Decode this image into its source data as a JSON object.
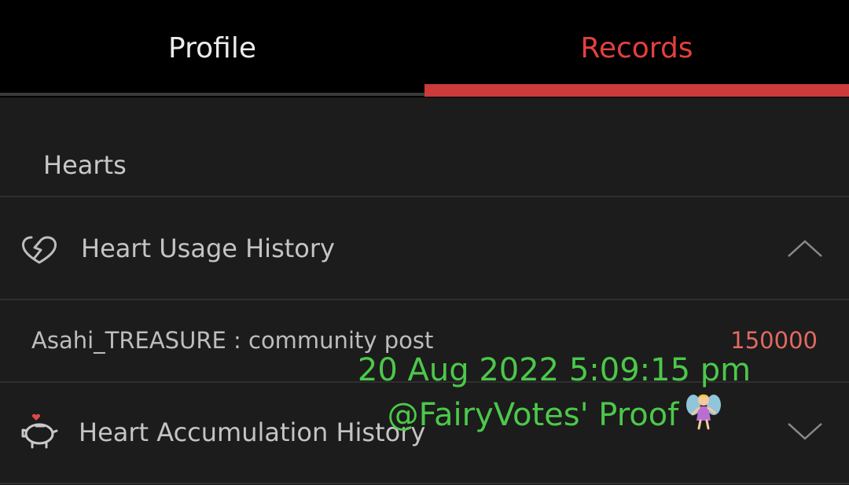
{
  "tabs": {
    "profile_label": "Profile",
    "records_label": "Records"
  },
  "section": {
    "title": "Hearts"
  },
  "usage": {
    "label": "Heart Usage History",
    "items": [
      {
        "name": "Asahi_TREASURE : community post",
        "amount": "150000"
      }
    ]
  },
  "accumulation": {
    "label": "Heart Accumulation History"
  },
  "watermark": {
    "line1": "20 Aug 2022 5:09:15 pm",
    "line2": "@FairyVotes' Proof"
  },
  "icons": {
    "usage": "heart-outline-icon",
    "accumulation": "piggy-bank-icon",
    "collapse": "chevron-up-icon",
    "expand": "chevron-down-icon",
    "fairy": "fairy-emoji-icon"
  },
  "colors": {
    "accent": "#e3403e",
    "amount": "#e26a62",
    "watermark": "#4cc84a"
  }
}
